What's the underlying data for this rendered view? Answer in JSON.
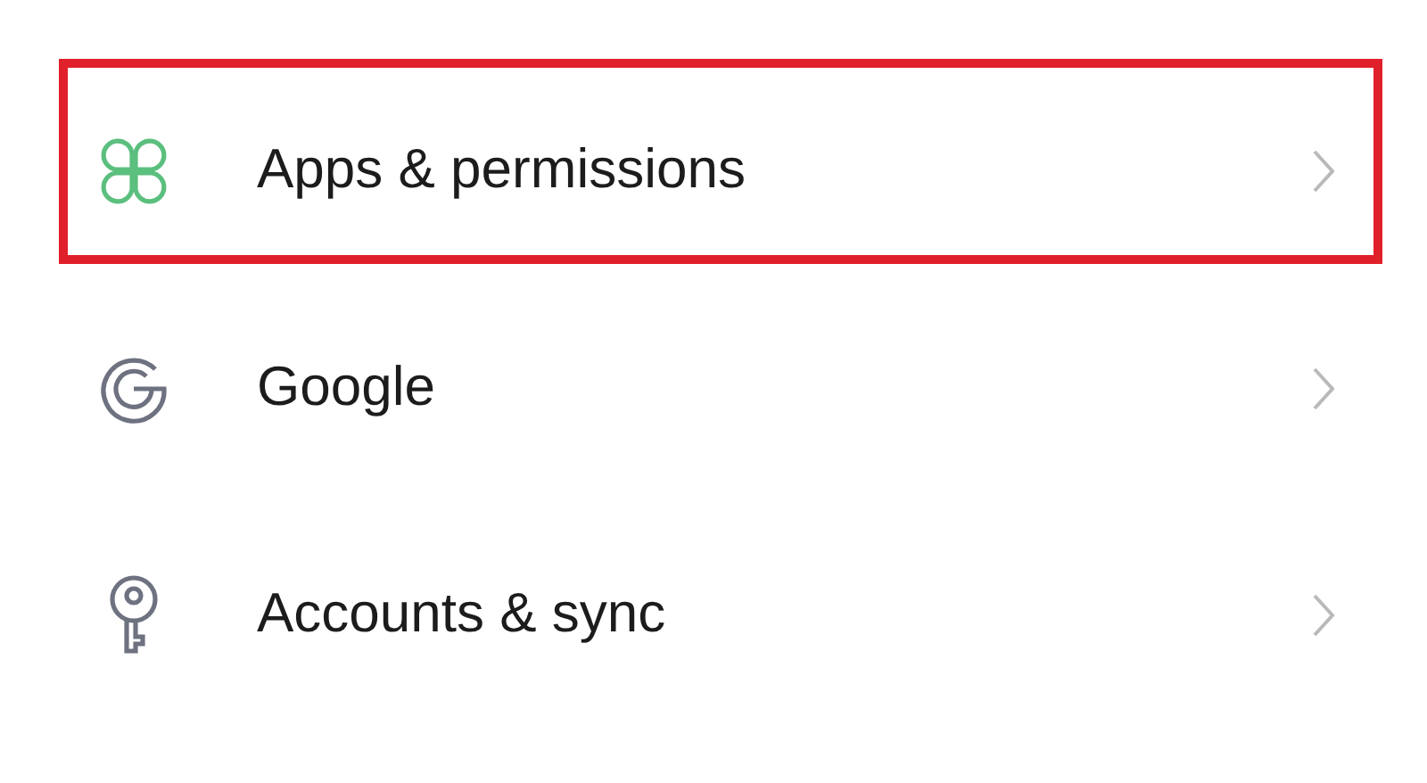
{
  "settings_items": [
    {
      "label": "Apps & permissions",
      "highlighted": true
    },
    {
      "label": "Google",
      "highlighted": false
    },
    {
      "label": "Accounts & sync",
      "highlighted": false
    }
  ]
}
